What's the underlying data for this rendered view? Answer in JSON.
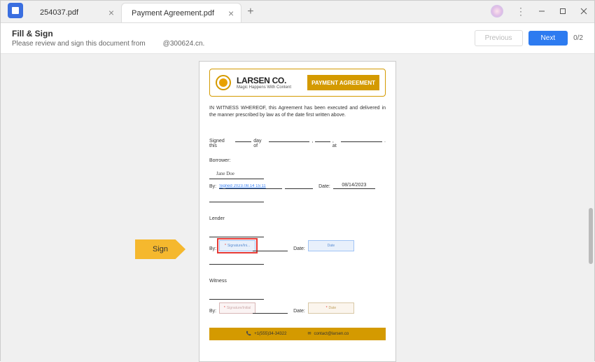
{
  "tabs": [
    {
      "label": "254037.pdf",
      "active": false
    },
    {
      "label": "Payment Agreement.pdf",
      "active": true
    }
  ],
  "header": {
    "title": "Fill & Sign",
    "subtitle_prefix": "Please review and sign this document from",
    "subtitle_from": "@300624.cn.",
    "previous": "Previous",
    "next": "Next",
    "counter": "0/2"
  },
  "sign_callout": "Sign",
  "document": {
    "company": "LARSEN CO.",
    "tagline": "Magic Happens With Content",
    "badge": "PAYMENT AGREEMENT",
    "witness": "IN WITNESS WHEREOF, this Agreement has been executed and delivered in the manner prescribed by law as of the date first written above.",
    "signed_this": "Signed this",
    "day_of": "day of",
    "at": ", at",
    "borrower": {
      "label": "Borrower:",
      "name": "Jane Doe",
      "by": "By:",
      "signature_text": "Signed 2023.08.14 15:11",
      "date_label": "Date:",
      "date_value": "08/14/2023"
    },
    "lender": {
      "label": "Lender",
      "by": "By:",
      "sig_placeholder": "Signature/Ini...",
      "date_label": "Date:",
      "date_placeholder": "Date"
    },
    "witness_role": {
      "label": "Witness",
      "by": "By:",
      "sig_placeholder": "Signature/Initial",
      "date_label": "Date:",
      "date_placeholder": "Date"
    },
    "footer": {
      "phone": "+1(555)34-34322",
      "email": "contact@larsen.co"
    }
  }
}
